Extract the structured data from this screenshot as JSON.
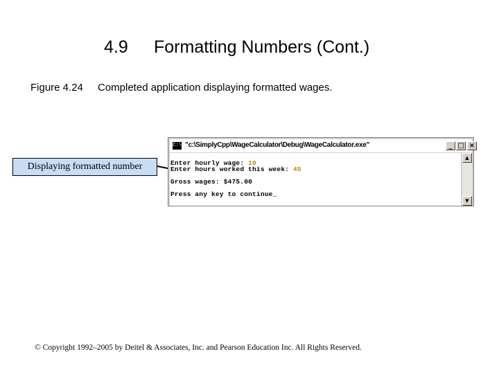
{
  "slide": {
    "section_number": "4.9",
    "title": "Formatting Numbers (Cont.)"
  },
  "caption": {
    "label": "Figure 4.24",
    "text": "Completed application displaying formatted wages."
  },
  "callout": {
    "text": "Displaying formatted number"
  },
  "console_window": {
    "icon_text": "C:\\",
    "title": "\"c:\\SimplyCpp\\WageCalculator\\Debug\\WageCalculator.exe\"",
    "controls": {
      "minimize": "_",
      "maximize": "□",
      "close": "×"
    },
    "lines": {
      "line1_prompt": "Enter hourly wage: ",
      "line1_value": "10",
      "line2_prompt": "Enter hours worked this week: ",
      "line2_value": "45",
      "line3_prompt": "Gross wages: ",
      "line3_value": "$475.00",
      "line4": "Press any key to continue_"
    },
    "scroll": {
      "up": "▲",
      "down": "▼"
    }
  },
  "footer": {
    "copyright": "© Copyright 1992–2005 by Deitel & Associates, Inc. and Pearson Education Inc. All Rights Reserved."
  }
}
